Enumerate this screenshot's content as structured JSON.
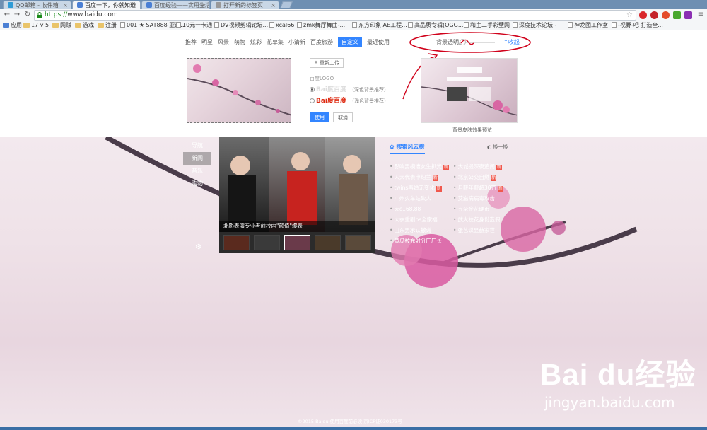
{
  "browser": {
    "tabs": [
      {
        "label": "QQ邮箱 - 收件箱",
        "active": false
      },
      {
        "label": "百度一下，你就知道",
        "active": true
      },
      {
        "label": "百度经验——实用生活",
        "active": false
      },
      {
        "label": "打开新的标签页",
        "active": false
      }
    ],
    "address": {
      "scheme": "https://",
      "host": "www.baidu.com"
    },
    "bookmarks": [
      {
        "label": "应用",
        "kind": "apps"
      },
      {
        "label": "17 v 5",
        "kind": "folder"
      },
      {
        "label": "网赚",
        "kind": "folder"
      },
      {
        "label": "游戏",
        "kind": "folder"
      },
      {
        "label": "注册",
        "kind": "folder"
      },
      {
        "label": "001 ★ SAT888 亚洲...",
        "kind": "page"
      },
      {
        "label": "10元一卡通",
        "kind": "page"
      },
      {
        "label": "DV视频剪辑论坛...",
        "kind": "page"
      },
      {
        "label": "xcal66",
        "kind": "page"
      },
      {
        "label": "zmk舞厅舞曲-...",
        "kind": "page"
      },
      {
        "label": "东方印象 AE工程...",
        "kind": "page"
      },
      {
        "label": "高品质专辑(OGG...",
        "kind": "page"
      },
      {
        "label": "和主二手彩壁网",
        "kind": "page"
      },
      {
        "label": "深度技术论坛 -",
        "kind": "page"
      },
      {
        "label": "神龙图工作室",
        "kind": "page"
      },
      {
        "label": "-视野-吧 打造全...",
        "kind": "page"
      }
    ]
  },
  "customize": {
    "categories": [
      {
        "label": "推荐",
        "active": false
      },
      {
        "label": "明星",
        "active": false
      },
      {
        "label": "风景",
        "active": false
      },
      {
        "label": "萌物",
        "active": false
      },
      {
        "label": "炫彩",
        "active": false
      },
      {
        "label": "花草集",
        "active": false
      },
      {
        "label": "小清新",
        "active": false
      },
      {
        "label": "百度旅游",
        "active": false
      },
      {
        "label": "自定义",
        "active": true
      },
      {
        "label": "最近使用",
        "active": false
      }
    ],
    "opacity_label": "背景透明度",
    "collapse_label": "收起",
    "upload_label": "重新上传",
    "logo_label": "百度LOGO",
    "logo_options": [
      {
        "logo": "Bai度百度",
        "hint": "（深色背景推荐）",
        "selected": true
      },
      {
        "logo": "Bai度百度",
        "hint": "（浅色背景推荐）",
        "selected": false
      }
    ],
    "apply_label": "使用",
    "cancel_label": "取消",
    "preview_caption": "背景皮肤效果预览"
  },
  "content": {
    "side_nav": [
      {
        "label": "导航",
        "active": false
      },
      {
        "label": "新闻",
        "active": true
      },
      {
        "label": "音乐",
        "active": false
      },
      {
        "label": "购物",
        "active": false
      }
    ],
    "news_caption": "北影表演专业考前校内\"颜值\"爆表",
    "hot_title": "搜索风云榜",
    "hot_swap": "换一换",
    "hot_items": [
      {
        "text": "影响男模遭女生扒光",
        "new": true
      },
      {
        "text": "大城提深夜追闹",
        "new": true
      },
      {
        "text": "人大代表申纪兰",
        "new": true
      },
      {
        "text": "北京公交自燃",
        "new": true
      },
      {
        "text": "twins再婚无变化",
        "new": true
      },
      {
        "text": "月薪年薪超30万",
        "new": true
      },
      {
        "text": "广州火车站砍人",
        "new": false
      },
      {
        "text": "艾滋病病毒攻击",
        "new": false
      },
      {
        "text": "天c168.88",
        "new": false
      },
      {
        "text": "五朵金花硬币",
        "new": false
      },
      {
        "text": "大衣重剧ps全家福",
        "new": false
      },
      {
        "text": "武大校花身份造假",
        "new": false
      },
      {
        "text": "山东男承认撒谎",
        "new": false
      },
      {
        "text": "张艺谋显赫家世",
        "new": false
      },
      {
        "text": "黄瓜被充射分厂厂长",
        "new": false
      }
    ],
    "footer": "©2015 Baidu 使用百度前必读 京ICP证030173号",
    "watermark_logo": "Bai du经验",
    "watermark_url": "jingyan.baidu.com"
  },
  "colors": {
    "accent": "#3385ff",
    "badge": "#f0584d",
    "annotation": "#d0021b"
  }
}
